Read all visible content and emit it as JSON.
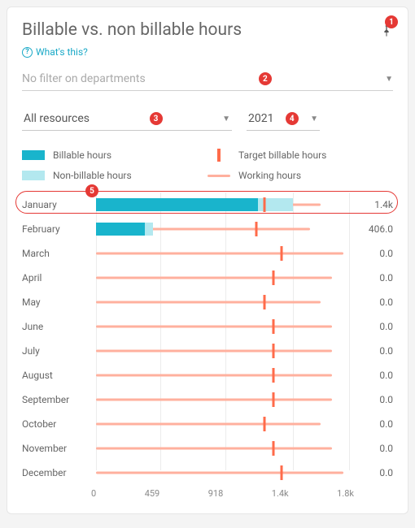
{
  "title": "Billable vs. non billable hours",
  "whats_this": "What's this?",
  "filter": {
    "placeholder": "No filter on departments"
  },
  "select_resources": {
    "label": "All resources"
  },
  "select_year": {
    "label": "2021"
  },
  "legend": {
    "billable": "Billable hours",
    "nonbillable": "Non-billable hours",
    "target": "Target billable hours",
    "working": "Working hours"
  },
  "annotations": {
    "b1": "1",
    "b2": "2",
    "b3": "3",
    "b4": "4",
    "b5": "5"
  },
  "axis": {
    "ticks": [
      "0",
      "459",
      "918",
      "1.4k",
      "1.8k"
    ]
  },
  "chart_data": {
    "type": "bar",
    "x_max": 1800,
    "categories": [
      "January",
      "February",
      "March",
      "April",
      "May",
      "June",
      "July",
      "August",
      "September",
      "October",
      "November",
      "December"
    ],
    "series": {
      "billable": [
        1150,
        350,
        0,
        0,
        0,
        0,
        0,
        0,
        0,
        0,
        0,
        0
      ],
      "nonbillable": [
        250,
        56,
        0,
        0,
        0,
        0,
        0,
        0,
        0,
        0,
        0,
        0
      ],
      "working": [
        1600,
        1520,
        1760,
        1680,
        1600,
        1680,
        1680,
        1680,
        1680,
        1600,
        1680,
        1760
      ],
      "target": [
        1200,
        1140,
        1320,
        1260,
        1200,
        1260,
        1260,
        1260,
        1260,
        1200,
        1260,
        1320
      ]
    },
    "value_labels": [
      "1.4k",
      "406.0",
      "0.0",
      "0.0",
      "0.0",
      "0.0",
      "0.0",
      "0.0",
      "0.0",
      "0.0",
      "0.0",
      "0.0"
    ],
    "xlabel": "",
    "ylabel": "",
    "title": "Billable vs. non billable hours"
  }
}
